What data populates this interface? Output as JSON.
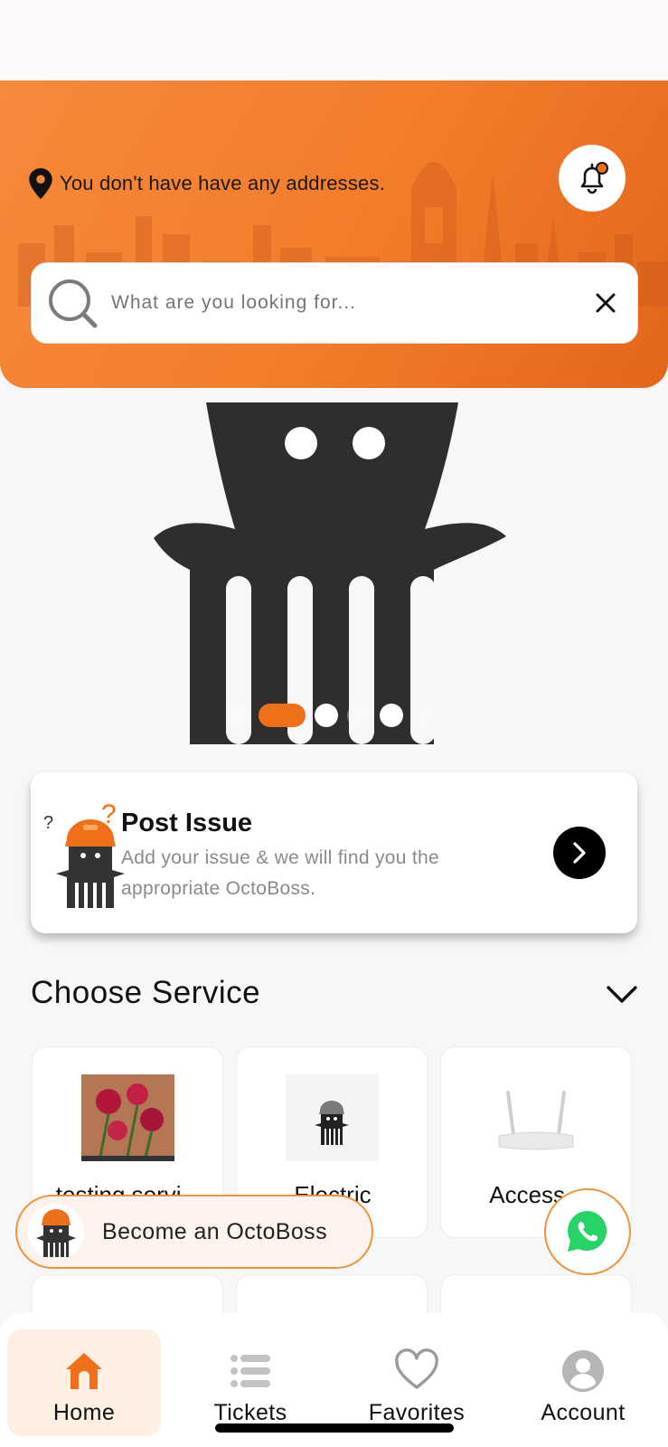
{
  "header": {
    "location_text": "You don't have have any addresses.",
    "notification_badge_color": "#f07019"
  },
  "search": {
    "placeholder": "What are you looking for..."
  },
  "banner": {
    "dot_count": 6,
    "active_dot_index": 1
  },
  "post_issue": {
    "title": "Post Issue",
    "subtitle": "Add your issue & we will find you the appropriate OctoBoss."
  },
  "services_section": {
    "title": "Choose Service",
    "items": [
      {
        "label": "testing servi...",
        "icon": "flower-photo"
      },
      {
        "label": "Electric",
        "icon": "octoboss-helmet-icon"
      },
      {
        "label": "Access...",
        "icon": "router-photo"
      }
    ]
  },
  "become": {
    "label": "Become an OctoBoss"
  },
  "whatsapp": {
    "icon": "whatsapp-icon",
    "color": "#25d366"
  },
  "bottom_nav": {
    "items": [
      {
        "label": "Home",
        "icon": "home-icon",
        "active": true
      },
      {
        "label": "Tickets",
        "icon": "list-icon",
        "active": false
      },
      {
        "label": "Favorites",
        "icon": "heart-icon",
        "active": false
      },
      {
        "label": "Account",
        "icon": "user-icon",
        "active": false
      }
    ]
  },
  "colors": {
    "accent": "#f07019",
    "header_gradient_start": "#f58a3a",
    "header_gradient_end": "#e2661a"
  }
}
